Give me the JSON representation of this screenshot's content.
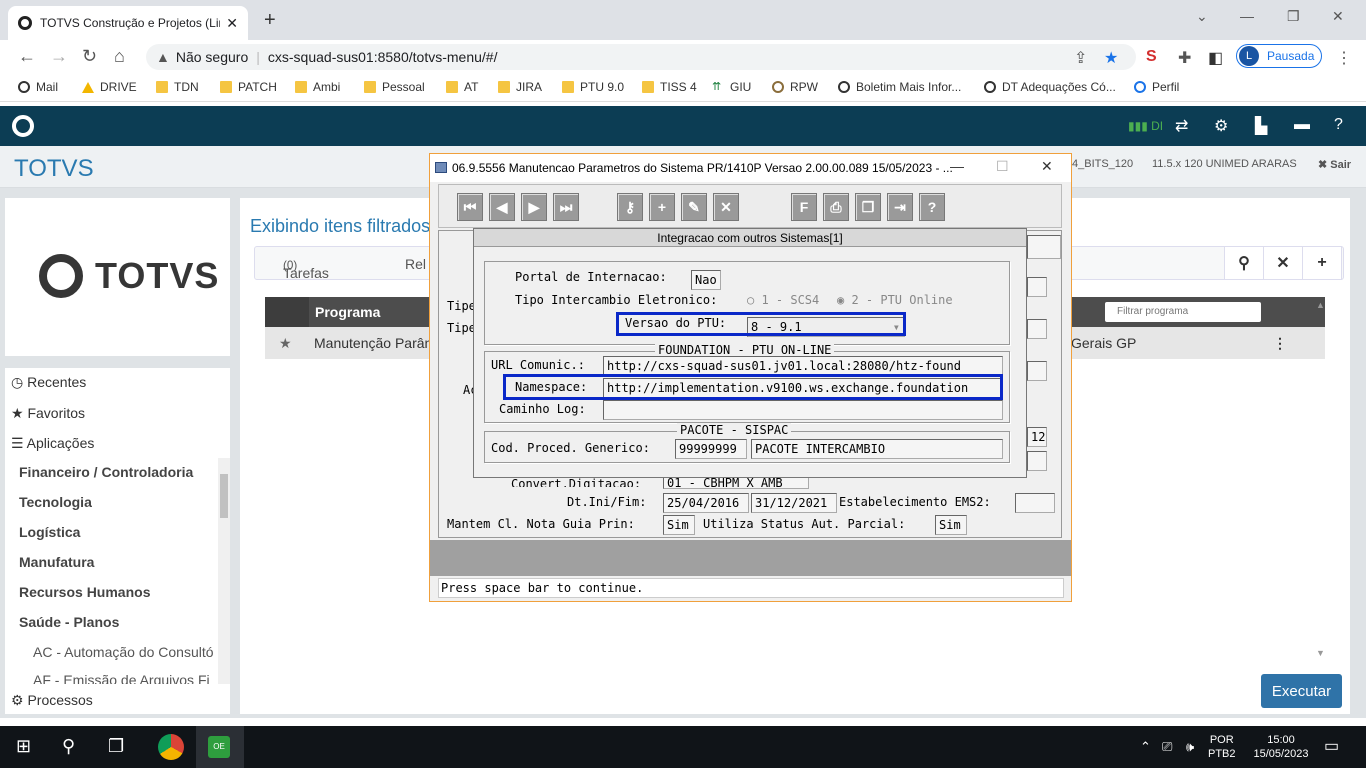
{
  "browser": {
    "tab_title": "TOTVS Construção e Projetos (Lin",
    "url_warning": "Não seguro",
    "url": "cxs-squad-sus01:8580/totvs-menu/#/",
    "profile_initial": "L",
    "profile_label": "Pausada",
    "bookmarks": [
      "Mail",
      "DRIVE",
      "TDN",
      "PATCH",
      "Ambi",
      "Pessoal",
      "AT",
      "JIRA",
      "PTU 9.0",
      "TISS 4",
      "GIU",
      "RPW",
      "Boletim Mais Infor...",
      "DT Adequações Có...",
      "Perfil"
    ]
  },
  "app": {
    "brand": "TOTVS",
    "header_info1": "4_BITS_120",
    "header_info2": "11.5.x 120 UNIMED ARARAS",
    "logout": "✖ Sair",
    "logo_text": "TOTVS",
    "left_menu": {
      "recentes": "Recentes",
      "favoritos": "Favoritos",
      "aplicacoes": "Aplicações",
      "items": [
        "Financeiro / Controladoria",
        "Tecnologia",
        "Logística",
        "Manufatura",
        "Recursos Humanos",
        "Saúde - Planos"
      ],
      "sub_items": [
        "AC - Automação do Consultó",
        "AF - Emissão de Arquivos Fi"
      ],
      "processos": "Processos"
    },
    "main": {
      "heading": "Exibindo itens filtrados",
      "tab_tarefas": "Tarefas",
      "tab_tarefas_count": "(0)",
      "tab_rel": "Rel",
      "grid_header": "Programa",
      "filter_placeholder": "Filtrar programa",
      "row_text": "Manutenção Parân",
      "row_right": "Gerais GP",
      "execute": "Executar"
    }
  },
  "dialog": {
    "title": "06.9.5556 Manutencao  Parametros do Sistema PR/1410P Versao 2.00.00.089 15/05/2023 - ...",
    "popup_title": "Integracao com outros Sistemas[1]",
    "portal_label": "Portal de Internacao:",
    "portal_value": "Nao",
    "tipo_label": "Tipo Intercambio Eletronico:",
    "tipo_opt1": "1 - SCS4",
    "tipo_opt2": "2 - PTU Online",
    "versao_label": "Versao do PTU:",
    "versao_value": "8 - 9.1",
    "group_ptu": "FOUNDATION - PTU ON-LINE",
    "url_label": "URL Comunic.:",
    "url_value": "http://cxs-squad-sus01.jv01.local:28080/htz-found",
    "ns_label": "Namespace:",
    "ns_value": "http://implementation.v9100.ws.exchange.foundation",
    "log_label": "Caminho Log:",
    "log_value": "",
    "group_pacote": "PACOTE - SISPAC",
    "cod_label": "Cod. Proced. Generico:",
    "cod_value": "99999999",
    "cod_desc": "PACOTE INTERCAMBIO",
    "bg_tipe1": "Tipe",
    "bg_tipe2": "Tipe",
    "bg_ac": "Ac",
    "bg_12": "12",
    "convert_label": "Convert.Digitacao:",
    "convert_value": "01 - CBHPM X AMB",
    "dt_label": "Dt.Ini/Fim:",
    "dt_ini": "25/04/2016",
    "dt_fim": "31/12/2021",
    "estab_label": "Estabelecimento EMS2:",
    "mantem_label": "Mantem Cl. Nota Guia Prin:",
    "mantem_value": "Sim",
    "utiliza_label": "Utiliza Status Aut. Parcial:",
    "utiliza_value": "Sim",
    "status": "Press space bar to continue."
  },
  "taskbar": {
    "lang1": "POR",
    "lang2": "PTB2",
    "time": "15:00",
    "date": "15/05/2023"
  }
}
